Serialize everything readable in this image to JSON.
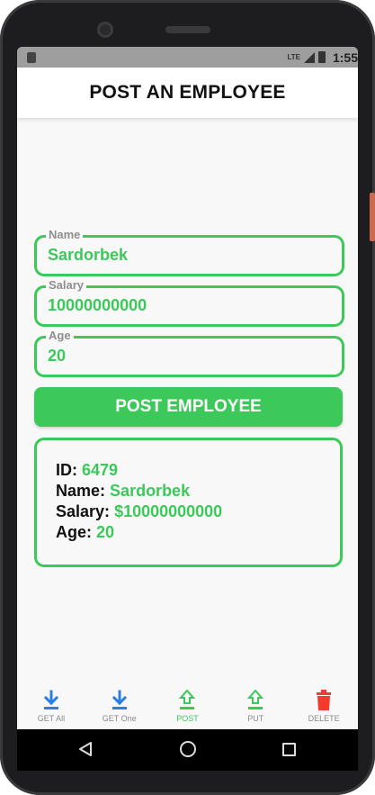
{
  "status_bar": {
    "network": "LTE",
    "time": "1:55"
  },
  "header": {
    "title": "POST AN EMPLOYEE"
  },
  "form": {
    "name": {
      "label": "Name",
      "value": "Sardorbek"
    },
    "salary": {
      "label": "Salary",
      "value": "10000000000"
    },
    "age": {
      "label": "Age",
      "value": "20"
    }
  },
  "post_button": {
    "label": "POST EMPLOYEE"
  },
  "result": {
    "id_label": "ID:",
    "id_value": "6479",
    "name_label": "Name:",
    "name_value": "Sardorbek",
    "salary_label": "Salary:",
    "salary_value": "$10000000000",
    "age_label": "Age:",
    "age_value": "20"
  },
  "bottom_nav": {
    "items": [
      {
        "label": "GET All",
        "icon": "download-icon",
        "color": "#2a7fe6"
      },
      {
        "label": "GET One",
        "icon": "download-icon",
        "color": "#2a7fe6"
      },
      {
        "label": "POST",
        "icon": "upload-icon",
        "color": "#3cc95a"
      },
      {
        "label": "PUT",
        "icon": "upload-icon",
        "color": "#3cc95a"
      },
      {
        "label": "DELETE",
        "icon": "trash-icon",
        "color": "#f23b2d"
      }
    ]
  },
  "colors": {
    "accent": "#3cc95a",
    "download": "#2a7fe6",
    "delete": "#f23b2d"
  }
}
